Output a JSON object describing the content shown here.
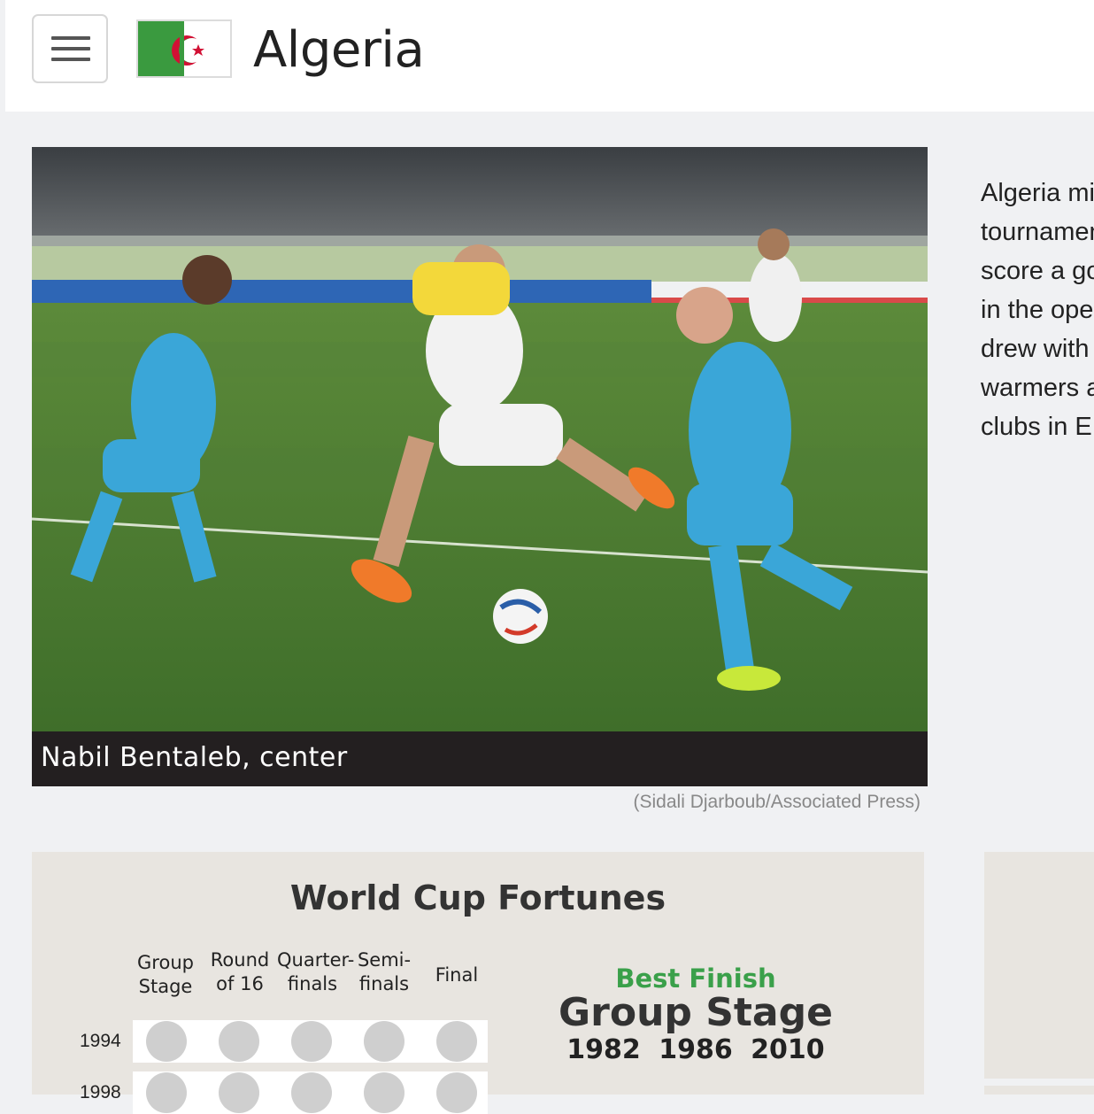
{
  "header": {
    "title": "Algeria",
    "menu_icon": "hamburger-menu-icon",
    "flag_icon": "algeria-flag-icon"
  },
  "photo": {
    "caption": "Nabil Bentaleb, center",
    "credit": "(Sidali Djarboub/Associated Press)"
  },
  "intro_lines": [
    "Algeria mi",
    "tournamen",
    "score a go",
    "in the ope",
    "drew with",
    "warmers a",
    "clubs in E"
  ],
  "graphic": {
    "title": "World Cup Fortunes",
    "columns": [
      {
        "line1": "Group",
        "line2": "Stage"
      },
      {
        "line1": "Round",
        "line2": "of 16"
      },
      {
        "line1": "Quarter-",
        "line2": "finals"
      },
      {
        "line1": "Semi-",
        "line2": "finals"
      },
      {
        "line1": "",
        "line2": "Final"
      }
    ],
    "rows": [
      {
        "year": "1994",
        "reached": [
          false,
          false,
          false,
          false,
          false
        ]
      },
      {
        "year": "1998",
        "reached": [
          false,
          false,
          false,
          false,
          false
        ]
      }
    ],
    "best_finish_label": "Best Finish",
    "best_finish_value": "Group Stage",
    "best_finish_years": "1982 1986 2010",
    "colors": {
      "accent_green": "#3aa04a",
      "dot_grey": "#cfcfcf"
    }
  }
}
